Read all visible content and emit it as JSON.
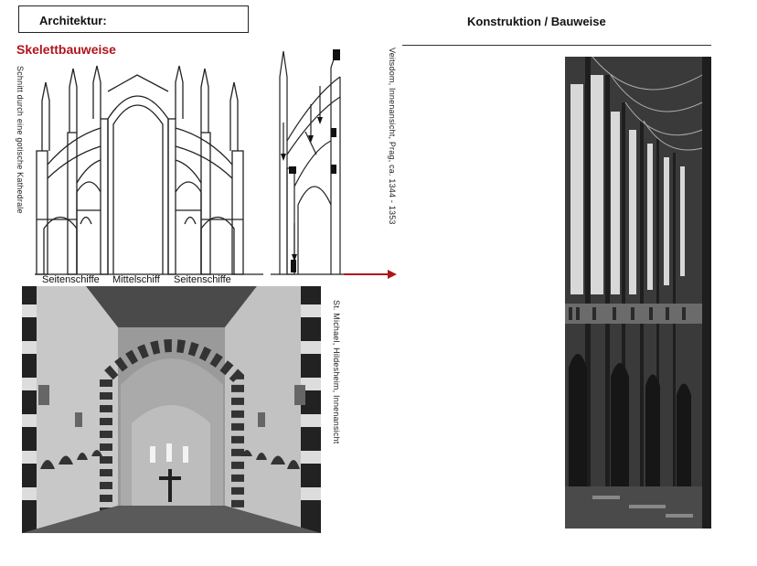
{
  "header": {
    "box_title": "Architektur:",
    "section_title": "Skelettbauweise",
    "right_title": "Konstruktion / Bauweise"
  },
  "captions": {
    "left_vertical": "Schnitt durch eine gotische Kathedrale",
    "middle_vertical": "Veitsdom, Innenansicht, Prag, ca. 1344 - 1353",
    "lower_vertical": "St. Michael, Hildesheim, Innenansicht"
  },
  "section_labels": {
    "left": "Seitenschiffe",
    "center": "Mittelschiff",
    "right": "Seitenschiffe"
  },
  "colors": {
    "accent_red": "#b0141c",
    "arrow_red": "#b0141c"
  }
}
